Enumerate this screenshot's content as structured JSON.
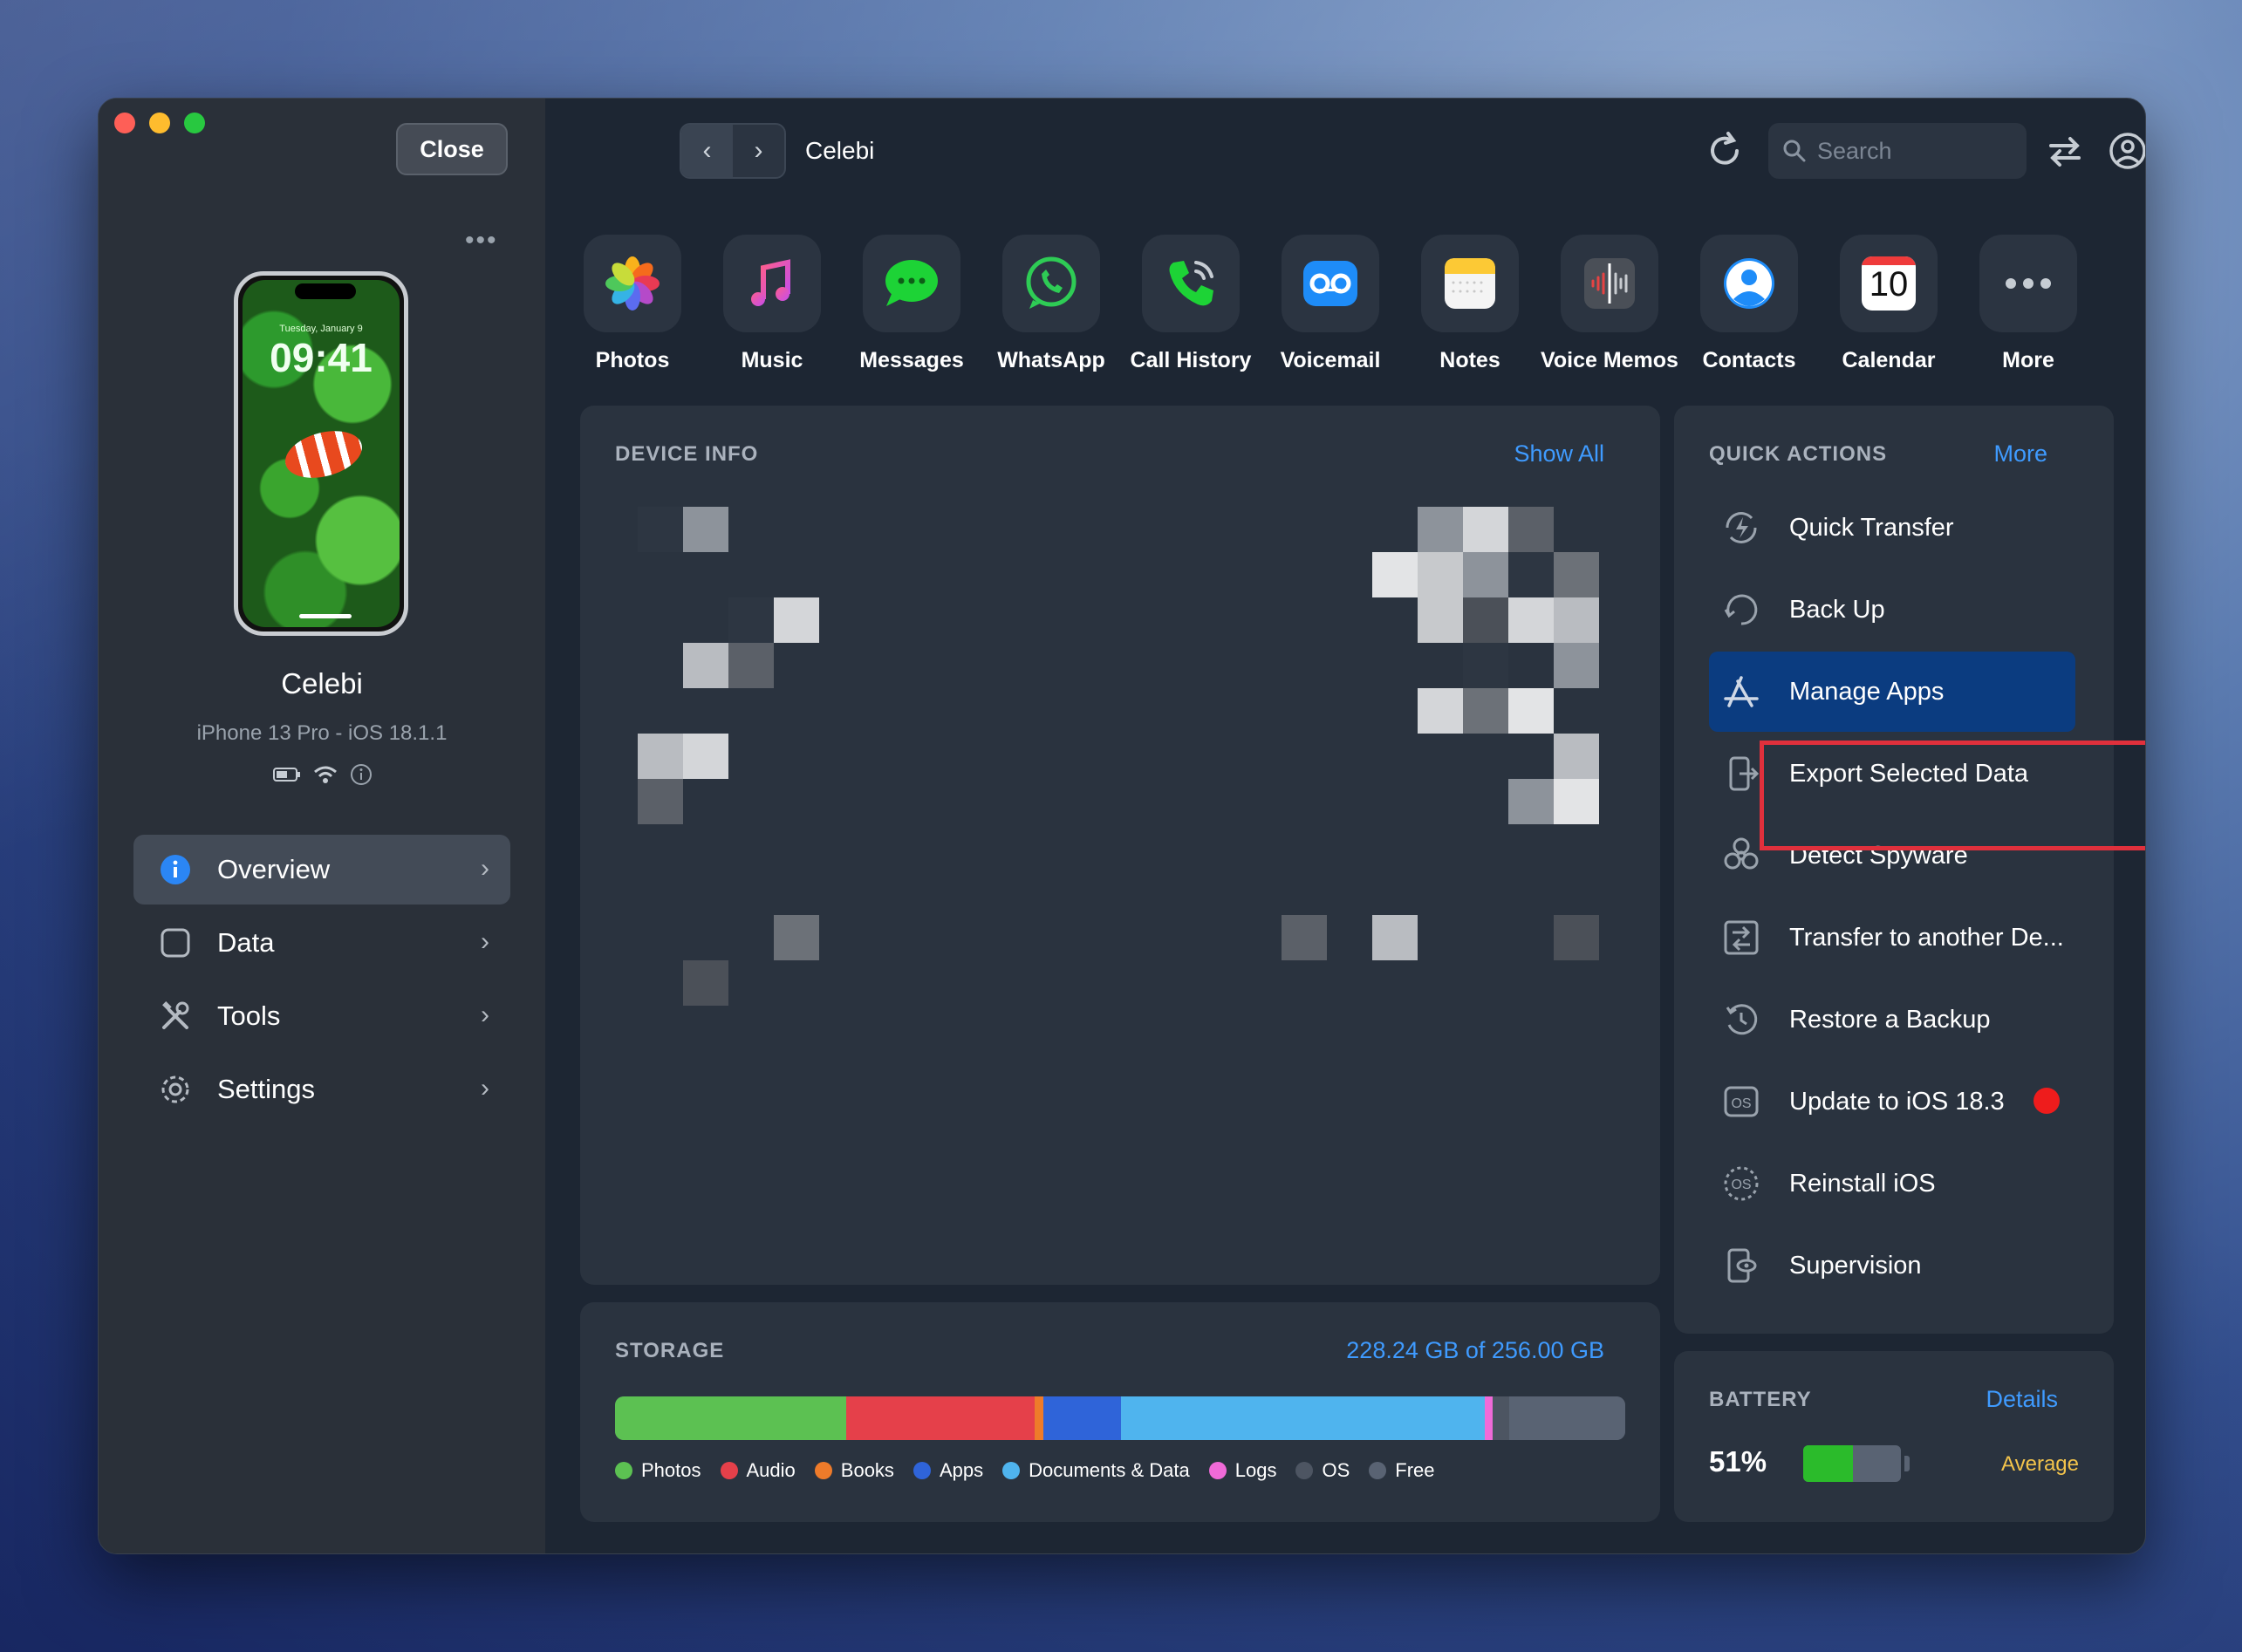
{
  "window": {
    "close_label": "Close",
    "sidebar_more": "•••"
  },
  "device": {
    "name": "Celebi",
    "model": "iPhone 13 Pro - iOS 18.1.1",
    "lock_date": "Tuesday, January 9",
    "lock_time": "09:41"
  },
  "sidebar": {
    "items": [
      {
        "label": "Overview",
        "icon": "info-icon",
        "active": true
      },
      {
        "label": "Data",
        "icon": "square-icon",
        "active": false
      },
      {
        "label": "Tools",
        "icon": "tools-icon",
        "active": false
      },
      {
        "label": "Settings",
        "icon": "gear-icon",
        "active": false
      }
    ]
  },
  "toolbar": {
    "title": "Celebi",
    "back": "‹",
    "forward": "›",
    "search_placeholder": "Search"
  },
  "apps": [
    {
      "label": "Photos",
      "icon": "photos-icon"
    },
    {
      "label": "Music",
      "icon": "music-icon"
    },
    {
      "label": "Messages",
      "icon": "messages-icon"
    },
    {
      "label": "WhatsApp",
      "icon": "whatsapp-icon"
    },
    {
      "label": "Call History",
      "icon": "phone-icon"
    },
    {
      "label": "Voicemail",
      "icon": "voicemail-icon"
    },
    {
      "label": "Notes",
      "icon": "notes-icon"
    },
    {
      "label": "Voice Memos",
      "icon": "voice-memos-icon"
    },
    {
      "label": "Contacts",
      "icon": "contacts-icon"
    },
    {
      "label": "Calendar",
      "icon": "calendar-icon",
      "day": "10"
    },
    {
      "label": "More",
      "icon": "more-icon"
    }
  ],
  "device_info": {
    "title": "DEVICE INFO",
    "link": "Show All"
  },
  "quick_actions": {
    "title": "QUICK ACTIONS",
    "link": "More",
    "items": [
      {
        "label": "Quick Transfer",
        "icon": "quick-transfer-icon"
      },
      {
        "label": "Back Up",
        "icon": "backup-icon"
      },
      {
        "label": "Manage Apps",
        "icon": "app-store-icon",
        "highlight": true
      },
      {
        "label": "Export Selected Data",
        "icon": "export-icon"
      },
      {
        "label": "Detect Spyware",
        "icon": "biohazard-icon"
      },
      {
        "label": "Transfer to another De...",
        "icon": "transfer-device-icon"
      },
      {
        "label": "Restore a Backup",
        "icon": "restore-icon"
      },
      {
        "label": "Update to iOS 18.3",
        "icon": "os-update-icon",
        "badge": true
      },
      {
        "label": "Reinstall iOS",
        "icon": "os-reinstall-icon"
      },
      {
        "label": "Supervision",
        "icon": "supervision-icon"
      }
    ]
  },
  "storage": {
    "title": "STORAGE",
    "usage": "228.24 GB of 256.00 GB",
    "segments": [
      {
        "label": "Photos",
        "fraction": 0.229,
        "color": "#5cc152"
      },
      {
        "label": "Audio",
        "fraction": 0.186,
        "color": "#e5404a"
      },
      {
        "label": "Books",
        "fraction": 0.009,
        "color": "#ee7b2a"
      },
      {
        "label": "Apps",
        "fraction": 0.077,
        "color": "#2f64d9"
      },
      {
        "label": "Documents & Data",
        "fraction": 0.36,
        "color": "#4fb4ee"
      },
      {
        "label": "Logs",
        "fraction": 0.008,
        "color": "#f06ad8"
      },
      {
        "label": "OS",
        "fraction": 0.016,
        "color": "#4d5562"
      },
      {
        "label": "Free",
        "fraction": 0.115,
        "color": "#596373"
      }
    ]
  },
  "battery": {
    "title": "BATTERY",
    "link": "Details",
    "percent": "51%",
    "level": 0.51,
    "health": "Average",
    "health_color": "#f2c34b"
  },
  "colors": {
    "accent": "#3f9bff",
    "highlight_box": "#e0303c",
    "active_action": "#0b3c80"
  }
}
